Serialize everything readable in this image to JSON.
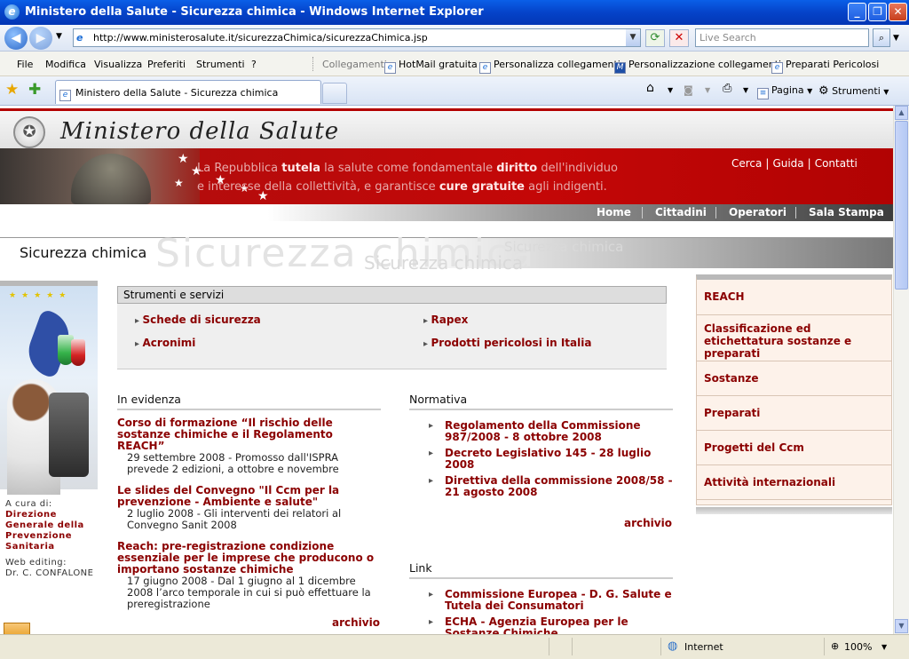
{
  "window": {
    "title": "Ministero della Salute - Sicurezza chimica - Windows Internet Explorer",
    "minimize": "_",
    "restore": "❐",
    "close": "✕"
  },
  "address": {
    "url": "http://www.ministerosalute.it/sicurezzaChimica/sicurezzaChimica.jsp",
    "search_placeholder": "Live Search"
  },
  "menu": [
    "File",
    "Modifica",
    "Visualizza",
    "Preferiti",
    "Strumenti",
    "?"
  ],
  "links": {
    "label": "Collegamenti",
    "items": [
      "HotMail gratuita",
      "Personalizza collegamenti",
      "Personalizzazione collegamenti",
      "Preparati Pericolosi"
    ]
  },
  "tab": {
    "title": "Ministero della Salute - Sicurezza chimica"
  },
  "toolbar": {
    "page": "Pagina",
    "tools": "Strumenti"
  },
  "site": {
    "logo": "Ministero della Salute",
    "slogan_line1": [
      {
        "t": "La Repubblica ",
        "b": false
      },
      {
        "t": "tutela",
        "b": true
      },
      {
        "t": " la salute come fondamentale ",
        "b": false
      },
      {
        "t": "diritto",
        "b": true
      },
      {
        "t": " dell'individuo",
        "b": false
      }
    ],
    "slogan_line2": [
      {
        "t": "e interesse della collettività, e garantisce ",
        "b": false
      },
      {
        "t": "cure gratuite",
        "b": true
      },
      {
        "t": " agli indigenti.",
        "b": false
      }
    ],
    "toplinks": [
      "Cerca",
      "Guida",
      "Contatti"
    ],
    "nav": [
      "Home",
      "Cittadini",
      "Operatori",
      "Sala Stampa"
    ],
    "section_title": "Sicurezza chimica",
    "tools_header": "Strumenti e servizi",
    "tools": [
      "Schede di sicurezza",
      "Rapex",
      "Acronimi",
      "Prodotti pericolosi in Italia"
    ],
    "evidenza_header": "In evidenza",
    "evidenza": [
      {
        "title": "Corso di formazione “Il rischio delle sostanze chimiche e il Regolamento REACH”",
        "desc": "29 settembre 2008 - Promosso dall'ISPRA prevede 2 edizioni, a ottobre e novembre"
      },
      {
        "title": "Le slides del Convegno \"Il Ccm per la prevenzione - Ambiente e salute\"",
        "desc": "2 luglio 2008 - Gli interventi dei relatori al Convegno Sanit 2008"
      },
      {
        "title": "Reach: pre-registrazione condizione essenziale per le imprese che producono o importano sostanze chimiche",
        "desc": "17 giugno 2008 - Dal 1 giugno al 1 dicembre 2008 l’arco temporale in cui si può effettuare la preregistrazione"
      }
    ],
    "archivio": "archivio",
    "normativa_header": "Normativa",
    "normativa": [
      "Regolamento della Commissione 987/2008 - 8 ottobre 2008",
      "Decreto Legislativo 145 - 28 luglio 2008",
      "Direttiva della commissione 2008/58 - 21 agosto 2008"
    ],
    "link_header": "Link",
    "link_items": [
      "Commissione Europea - D. G. Salute e Tutela dei Consumatori",
      "ECHA - Agenzia Europea per le Sostanze Chimiche"
    ],
    "cura_label": "A cura di:",
    "cura_org": "Direzione Generale della Prevenzione Sanitaria",
    "web_label": "Web editing:",
    "web_name": "Dr. C. CONFALONE",
    "right_menu": [
      "REACH",
      "Classificazione ed etichettatura sostanze e preparati",
      "Sostanze",
      "Preparati",
      "Progetti del Ccm",
      "Attività internazionali"
    ]
  },
  "status": {
    "zone": "Internet",
    "zoom": "100%"
  }
}
